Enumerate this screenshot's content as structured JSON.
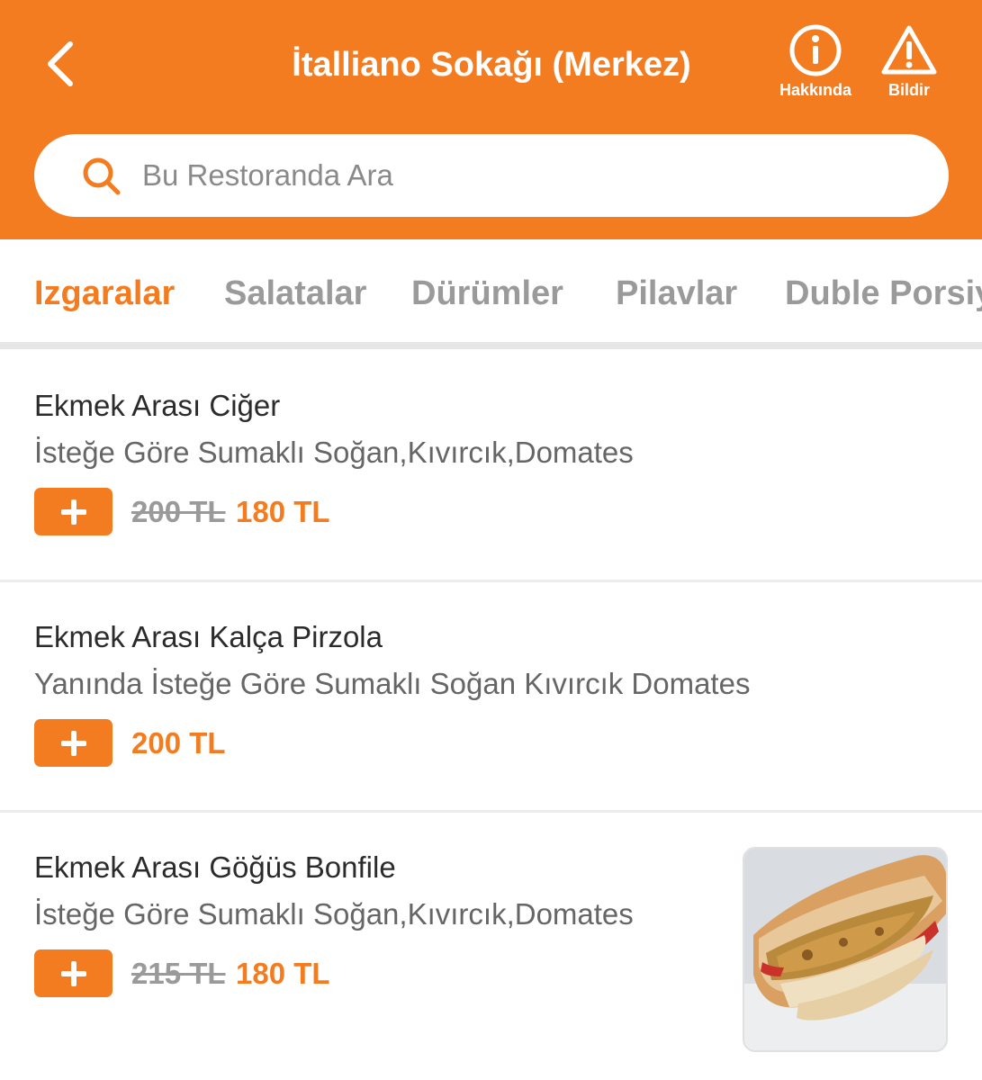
{
  "header": {
    "title": "İtalliano Sokağı (Merkez)",
    "about_label": "Hakkında",
    "report_label": "Bildir",
    "color": "#F47C20"
  },
  "search": {
    "placeholder": "Bu Restoranda Ara"
  },
  "tabs": [
    {
      "label": "Izgaralar",
      "active": true
    },
    {
      "label": "Salatalar",
      "active": false
    },
    {
      "label": "Dürümler",
      "active": false
    },
    {
      "label": "Pilavlar",
      "active": false
    },
    {
      "label": "Duble Porsiy",
      "active": false
    }
  ],
  "menu_items": [
    {
      "name": "Ekmek Arası Ciğer",
      "description": "İsteğe Göre Sumaklı Soğan,Kıvırcık,Domates",
      "old_price": "200 TL",
      "price": "180 TL",
      "has_photo": false
    },
    {
      "name": "Ekmek Arası Kalça Pirzola",
      "description": "Yanında İsteğe Göre Sumaklı Soğan Kıvırcık Domates",
      "old_price": "",
      "price": "200 TL",
      "has_photo": false
    },
    {
      "name": "Ekmek Arası Göğüs Bonfile",
      "description": "İsteğe Göre Sumaklı Soğan,Kıvırcık,Domates",
      "old_price": "215 TL",
      "price": "180 TL",
      "has_photo": true
    }
  ],
  "icons": {
    "back": "chevron-left-icon",
    "about": "info-icon",
    "report": "warning-icon",
    "search": "search-icon",
    "add": "plus-icon"
  }
}
